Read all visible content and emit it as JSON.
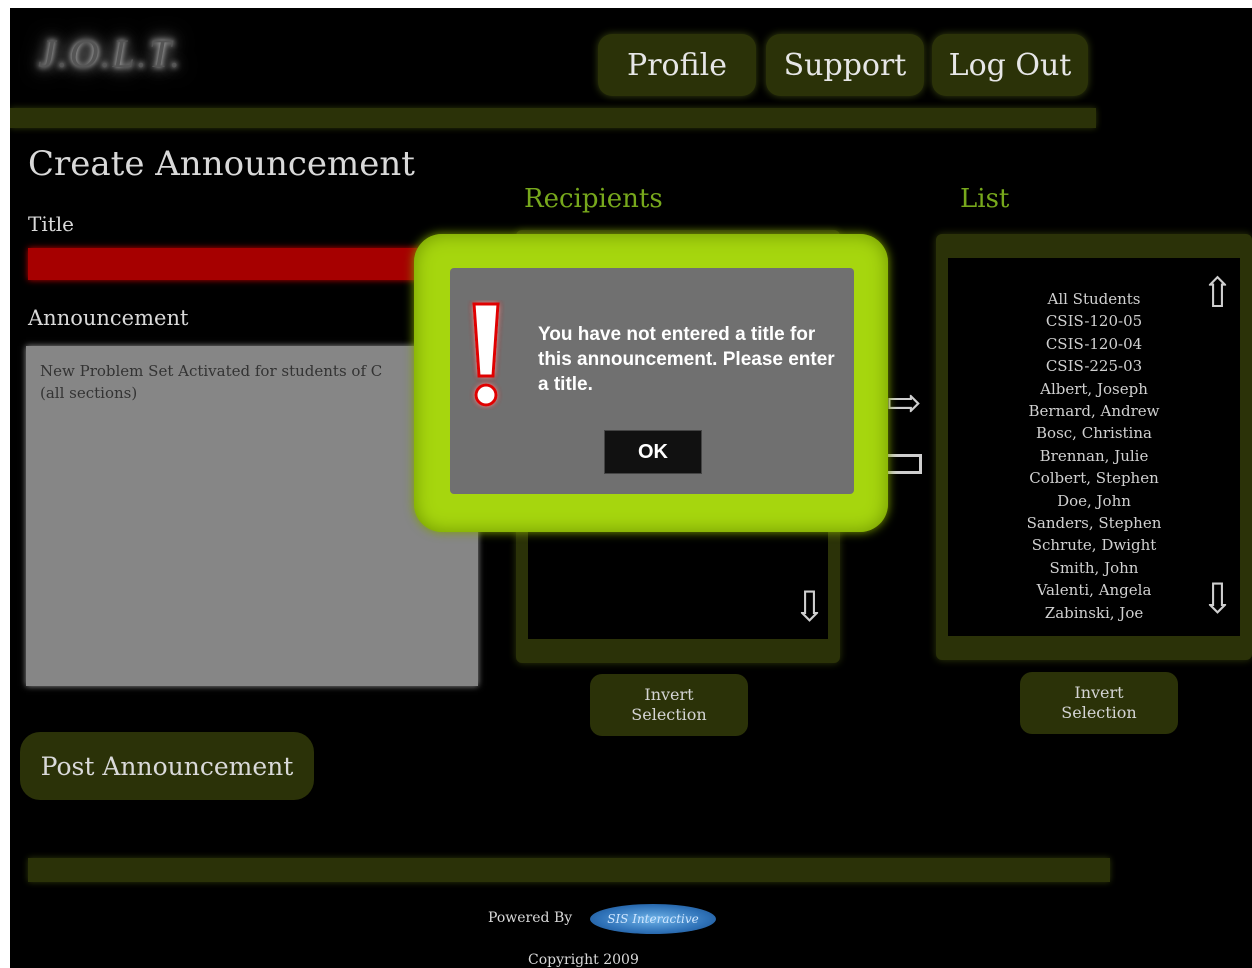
{
  "app": {
    "logo": "J.O.L.T."
  },
  "nav": {
    "profile": "Profile",
    "support": "Support",
    "logout": "Log Out"
  },
  "page": {
    "title": "Create Announcement"
  },
  "form": {
    "title_label": "Title",
    "title_value": "",
    "announcement_label": "Announcement",
    "announcement_text": "New Problem Set Activated for students of C\n(all sections)",
    "post_button": "Post Announcement"
  },
  "recipients": {
    "heading": "Recipients",
    "invert_line1": "Invert",
    "invert_line2": "Selection",
    "down_icon": "down-arrow-icon",
    "add_icon": "right-arrow-icon",
    "remove_icon": "left-arrow-icon"
  },
  "list": {
    "heading": "List",
    "items": [
      "All Students",
      "CSIS-120-05",
      "CSIS-120-04",
      "CSIS-225-03",
      "Albert, Joseph",
      "Bernard, Andrew",
      "Bosc, Christina",
      "Brennan, Julie",
      "Colbert, Stephen",
      "Doe, John",
      "Sanders, Stephen",
      "Schrute, Dwight",
      "Smith, John",
      "Valenti, Angela",
      "Zabinski, Joe"
    ],
    "invert_line1": "Invert",
    "invert_line2": "Selection",
    "up_icon": "up-arrow-icon",
    "down_icon": "down-arrow-icon"
  },
  "footer": {
    "powered_by": "Powered By",
    "company_logo": "SIS Interactive",
    "copyright": "Copyright 2009"
  },
  "modal": {
    "message": "You have not entered a title for this announcement. Please enter a title.",
    "ok": "OK",
    "icon": "exclamation-icon"
  },
  "colors": {
    "background": "#000000",
    "accent_dark": "#2b3208",
    "heading_green": "#77a81c",
    "modal_frame": "#a6d60e",
    "error_field": "#a60000"
  }
}
